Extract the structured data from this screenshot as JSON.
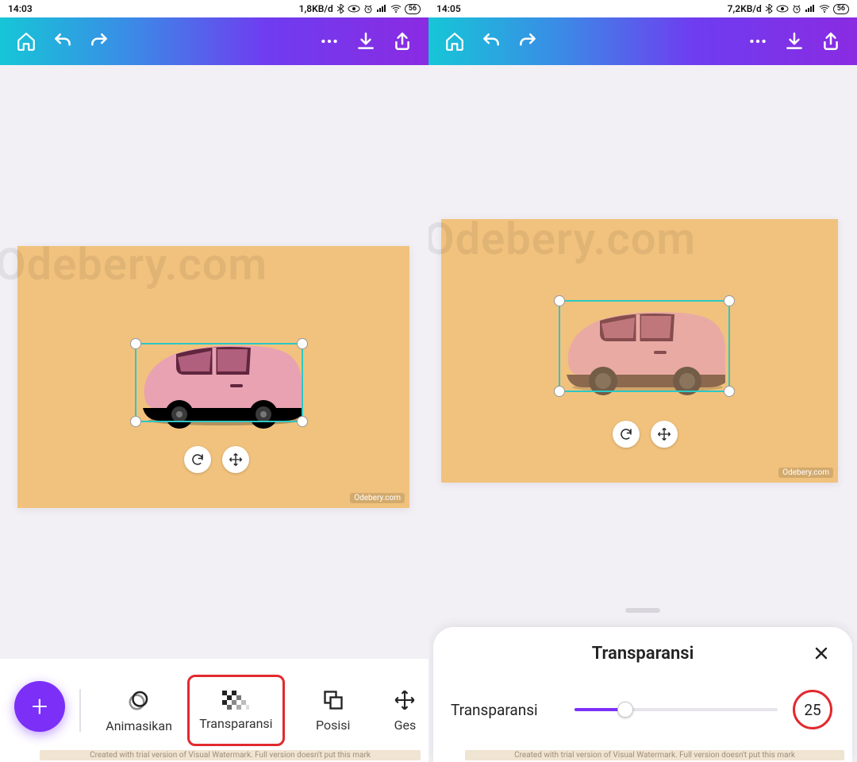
{
  "left": {
    "status": {
      "time": "14:03",
      "net": "1,8KB/d",
      "battery": "56"
    },
    "watermark": "Odebery.com",
    "design_tag": "Odebery.com",
    "tools": {
      "animate": "Animasikan",
      "transparency": "Transparansi",
      "position": "Posisi",
      "gesture": "Ges"
    },
    "trial": "Created with trial version of Visual Watermark. Full version doesn't put this mark"
  },
  "right": {
    "status": {
      "time": "14:05",
      "net": "7,2KB/d",
      "battery": "56"
    },
    "watermark": "Odebery.com",
    "design_tag": "Odebery.com",
    "sheet": {
      "title": "Transparansi",
      "label": "Transparansi",
      "value": "25",
      "percent": 25
    },
    "trial": "Created with trial version of Visual Watermark. Full version doesn't put this mark"
  }
}
